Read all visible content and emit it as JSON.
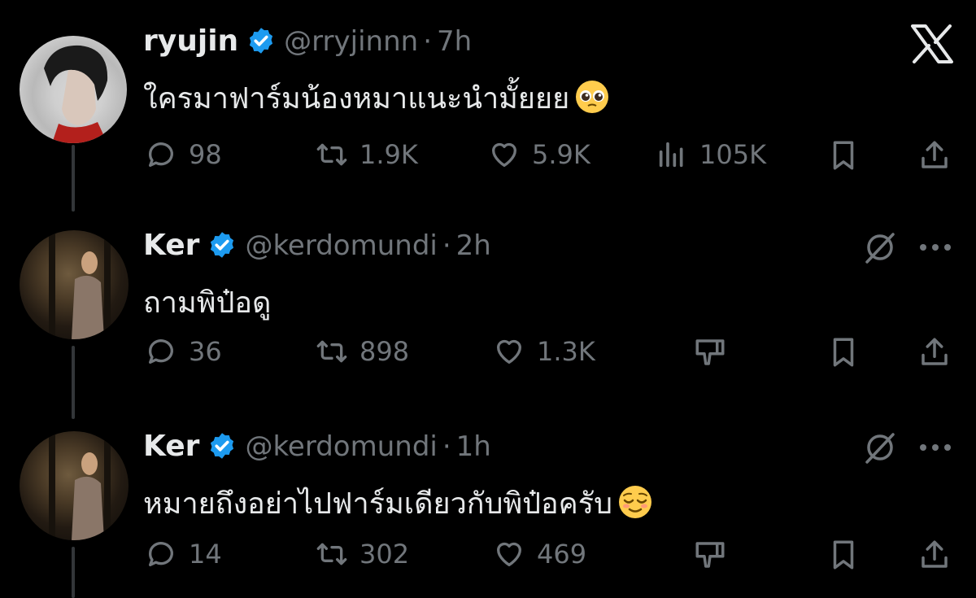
{
  "tweets": [
    {
      "name": "ryujin",
      "handle": "@rryjinnn",
      "time": "7h",
      "text": "ใครมาฟาร์มน้องหมาแนะนำมั้ยยย",
      "emoji": "pleading-face",
      "replies": "98",
      "retweets": "1.9K",
      "likes": "5.9K",
      "views": "105K"
    },
    {
      "name": "Ker",
      "handle": "@kerdomundi",
      "time": "2h",
      "text": "ถามพิป๋อดู",
      "replies": "36",
      "retweets": "898",
      "likes": "1.3K"
    },
    {
      "name": "Ker",
      "handle": "@kerdomundi",
      "time": "1h",
      "text": "หมายถึงอย่าไปฟาร์มเดียวกับพิป๋อครับ",
      "emoji": "relieved-face",
      "replies": "14",
      "retweets": "302",
      "likes": "469"
    }
  ],
  "dot": "·",
  "colors": {
    "verified": "#1d9bf0",
    "muted": "#71767b",
    "text": "#e7e9ea"
  }
}
